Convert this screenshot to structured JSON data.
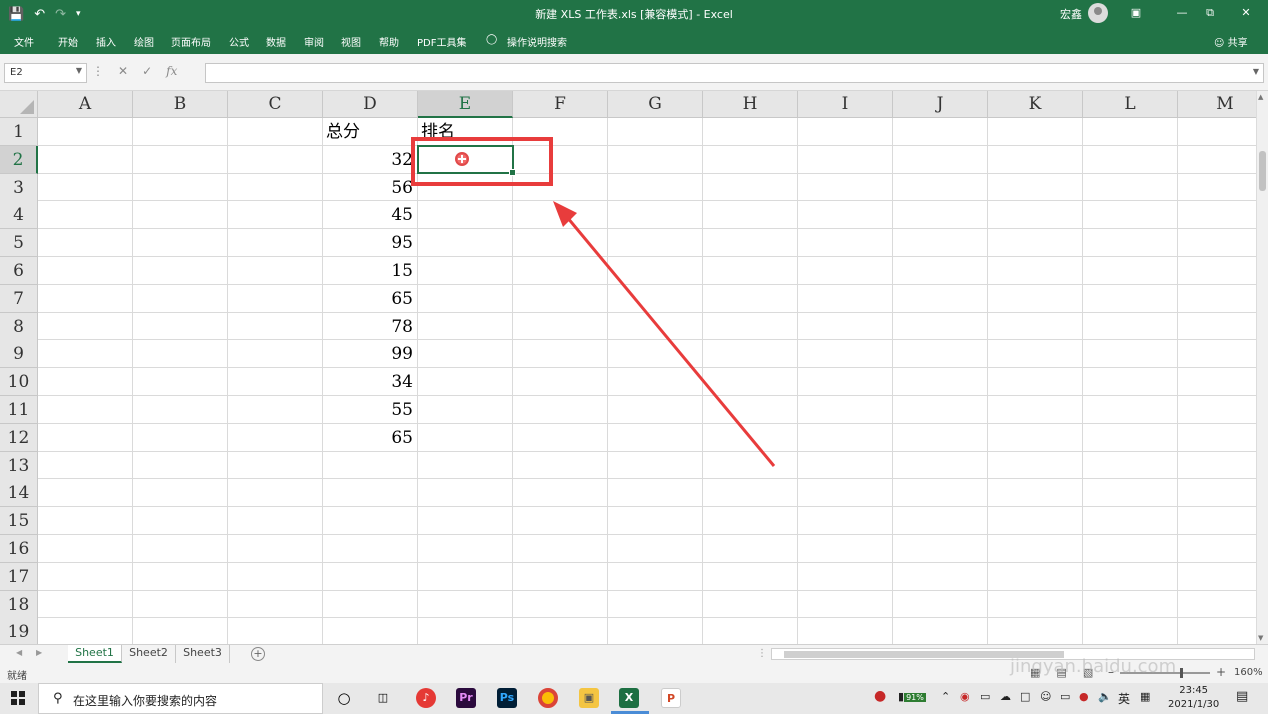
{
  "titlebar": {
    "doc_title": "新建 XLS 工作表.xls [兼容模式] - Excel",
    "user": "宏鑫",
    "save_icon": "save-icon",
    "undo_icon": "undo-icon",
    "redo_icon": "redo-icon"
  },
  "ribbon": {
    "tabs": [
      "文件",
      "开始",
      "插入",
      "绘图",
      "页面布局",
      "公式",
      "数据",
      "审阅",
      "视图",
      "帮助",
      "PDF工具集",
      "操作说明搜索"
    ],
    "share": "共享"
  },
  "formula_bar": {
    "name_box": "E2",
    "fx": "fx",
    "content": ""
  },
  "columns": [
    "A",
    "B",
    "C",
    "D",
    "E",
    "F",
    "G",
    "H",
    "I",
    "J",
    "K",
    "L",
    "M"
  ],
  "rows": [
    "1",
    "2",
    "3",
    "4",
    "5",
    "6",
    "7",
    "8",
    "9",
    "10",
    "11",
    "12",
    "13",
    "14",
    "15",
    "16",
    "17",
    "18",
    "19"
  ],
  "cells": {
    "D1": "总分",
    "E1": "排名",
    "D_values": [
      "32",
      "56",
      "45",
      "95",
      "15",
      "65",
      "78",
      "99",
      "34",
      "55",
      "65"
    ]
  },
  "sheets": [
    "Sheet1",
    "Sheet2",
    "Sheet3"
  ],
  "status": {
    "ready": "就绪",
    "zoom": "160%"
  },
  "taskbar": {
    "search_placeholder": "在这里输入你要搜索的内容",
    "battery": "91%",
    "ime": "英",
    "time": "23:45",
    "date": "2021/1/30"
  },
  "watermark": {
    "logo": "Baidu经验",
    "url": "jingyan.baidu.com"
  },
  "colors": {
    "excel_green": "#217346",
    "annotation_red": "#e83c3c"
  }
}
